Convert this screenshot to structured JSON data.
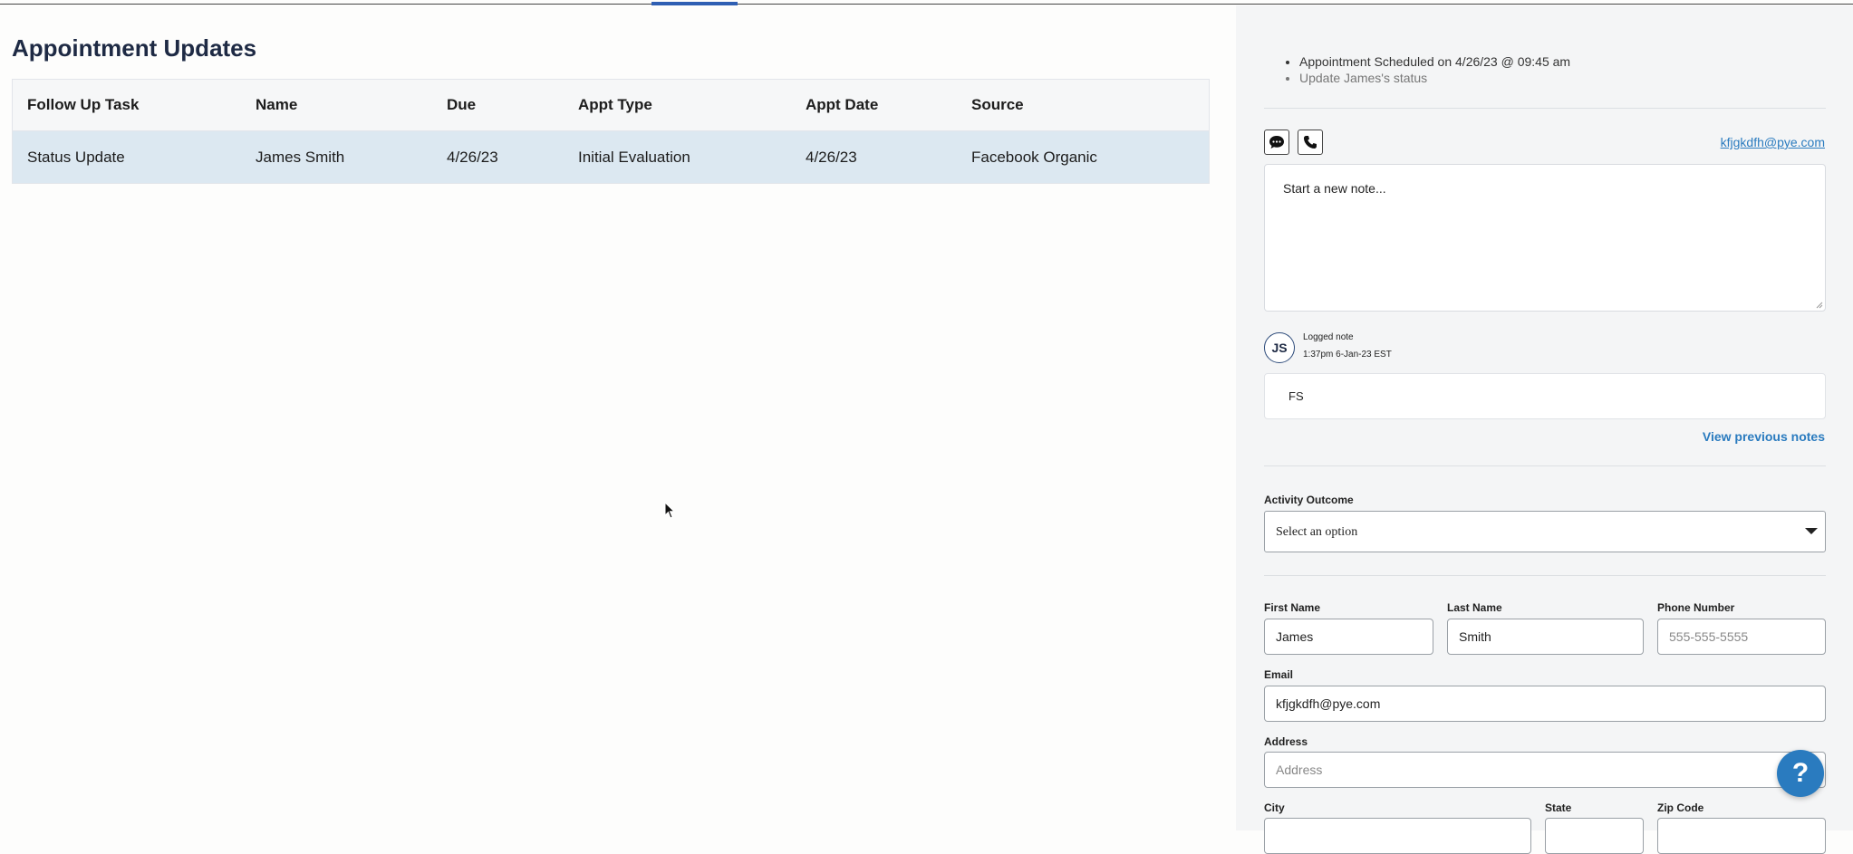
{
  "page": {
    "title": "Appointment Updates"
  },
  "table": {
    "headers": [
      "Follow Up Task",
      "Name",
      "Due",
      "Appt Type",
      "Appt Date",
      "Source"
    ],
    "rows": [
      [
        "Status Update",
        "James Smith",
        "4/26/23",
        "Initial Evaluation",
        "4/26/23",
        "Facebook Organic"
      ]
    ]
  },
  "detail": {
    "bullets": [
      "Appointment Scheduled on 4/26/23 @ 09:45 am",
      "Update James's status"
    ],
    "icons": {
      "message": "chat-bubble-icon",
      "phone": "phone-icon",
      "help": "question-mark-icon"
    },
    "email_link": "kfjgkdfh@pye.com",
    "note_placeholder": "Start a new note...",
    "logged_note": {
      "avatar_initials": "JS",
      "title": "Logged note",
      "time": "1:37pm 6-Jan-23 EST",
      "body": "FS"
    },
    "view_previous_label": "View previous notes",
    "activity_outcome": {
      "label": "Activity Outcome",
      "selected": "Select an option"
    },
    "form": {
      "first_name_label": "First Name",
      "first_name_value": "James",
      "last_name_label": "Last Name",
      "last_name_value": "Smith",
      "phone_label": "Phone Number",
      "phone_placeholder": "555-555-5555",
      "email_label": "Email",
      "email_value": "kfjgkdfh@pye.com",
      "address_label": "Address",
      "address_placeholder": "Address",
      "city_label": "City",
      "state_label": "State",
      "zip_label": "Zip Code"
    },
    "help_label": "?"
  },
  "colors": {
    "accent": "#2a7bbf",
    "row_selected": "#dce8f1",
    "title": "#1e2a44"
  }
}
